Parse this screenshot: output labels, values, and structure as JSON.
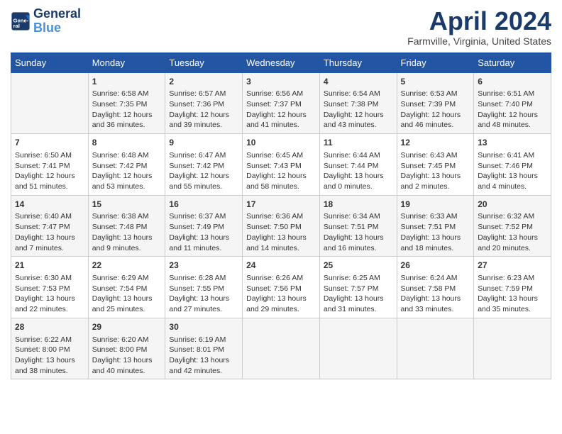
{
  "header": {
    "logo_line1": "General",
    "logo_line2": "Blue",
    "month": "April 2024",
    "location": "Farmville, Virginia, United States"
  },
  "weekdays": [
    "Sunday",
    "Monday",
    "Tuesday",
    "Wednesday",
    "Thursday",
    "Friday",
    "Saturday"
  ],
  "weeks": [
    [
      {
        "day": "",
        "info": ""
      },
      {
        "day": "1",
        "info": "Sunrise: 6:58 AM\nSunset: 7:35 PM\nDaylight: 12 hours\nand 36 minutes."
      },
      {
        "day": "2",
        "info": "Sunrise: 6:57 AM\nSunset: 7:36 PM\nDaylight: 12 hours\nand 39 minutes."
      },
      {
        "day": "3",
        "info": "Sunrise: 6:56 AM\nSunset: 7:37 PM\nDaylight: 12 hours\nand 41 minutes."
      },
      {
        "day": "4",
        "info": "Sunrise: 6:54 AM\nSunset: 7:38 PM\nDaylight: 12 hours\nand 43 minutes."
      },
      {
        "day": "5",
        "info": "Sunrise: 6:53 AM\nSunset: 7:39 PM\nDaylight: 12 hours\nand 46 minutes."
      },
      {
        "day": "6",
        "info": "Sunrise: 6:51 AM\nSunset: 7:40 PM\nDaylight: 12 hours\nand 48 minutes."
      }
    ],
    [
      {
        "day": "7",
        "info": "Sunrise: 6:50 AM\nSunset: 7:41 PM\nDaylight: 12 hours\nand 51 minutes."
      },
      {
        "day": "8",
        "info": "Sunrise: 6:48 AM\nSunset: 7:42 PM\nDaylight: 12 hours\nand 53 minutes."
      },
      {
        "day": "9",
        "info": "Sunrise: 6:47 AM\nSunset: 7:42 PM\nDaylight: 12 hours\nand 55 minutes."
      },
      {
        "day": "10",
        "info": "Sunrise: 6:45 AM\nSunset: 7:43 PM\nDaylight: 12 hours\nand 58 minutes."
      },
      {
        "day": "11",
        "info": "Sunrise: 6:44 AM\nSunset: 7:44 PM\nDaylight: 13 hours\nand 0 minutes."
      },
      {
        "day": "12",
        "info": "Sunrise: 6:43 AM\nSunset: 7:45 PM\nDaylight: 13 hours\nand 2 minutes."
      },
      {
        "day": "13",
        "info": "Sunrise: 6:41 AM\nSunset: 7:46 PM\nDaylight: 13 hours\nand 4 minutes."
      }
    ],
    [
      {
        "day": "14",
        "info": "Sunrise: 6:40 AM\nSunset: 7:47 PM\nDaylight: 13 hours\nand 7 minutes."
      },
      {
        "day": "15",
        "info": "Sunrise: 6:38 AM\nSunset: 7:48 PM\nDaylight: 13 hours\nand 9 minutes."
      },
      {
        "day": "16",
        "info": "Sunrise: 6:37 AM\nSunset: 7:49 PM\nDaylight: 13 hours\nand 11 minutes."
      },
      {
        "day": "17",
        "info": "Sunrise: 6:36 AM\nSunset: 7:50 PM\nDaylight: 13 hours\nand 14 minutes."
      },
      {
        "day": "18",
        "info": "Sunrise: 6:34 AM\nSunset: 7:51 PM\nDaylight: 13 hours\nand 16 minutes."
      },
      {
        "day": "19",
        "info": "Sunrise: 6:33 AM\nSunset: 7:51 PM\nDaylight: 13 hours\nand 18 minutes."
      },
      {
        "day": "20",
        "info": "Sunrise: 6:32 AM\nSunset: 7:52 PM\nDaylight: 13 hours\nand 20 minutes."
      }
    ],
    [
      {
        "day": "21",
        "info": "Sunrise: 6:30 AM\nSunset: 7:53 PM\nDaylight: 13 hours\nand 22 minutes."
      },
      {
        "day": "22",
        "info": "Sunrise: 6:29 AM\nSunset: 7:54 PM\nDaylight: 13 hours\nand 25 minutes."
      },
      {
        "day": "23",
        "info": "Sunrise: 6:28 AM\nSunset: 7:55 PM\nDaylight: 13 hours\nand 27 minutes."
      },
      {
        "day": "24",
        "info": "Sunrise: 6:26 AM\nSunset: 7:56 PM\nDaylight: 13 hours\nand 29 minutes."
      },
      {
        "day": "25",
        "info": "Sunrise: 6:25 AM\nSunset: 7:57 PM\nDaylight: 13 hours\nand 31 minutes."
      },
      {
        "day": "26",
        "info": "Sunrise: 6:24 AM\nSunset: 7:58 PM\nDaylight: 13 hours\nand 33 minutes."
      },
      {
        "day": "27",
        "info": "Sunrise: 6:23 AM\nSunset: 7:59 PM\nDaylight: 13 hours\nand 35 minutes."
      }
    ],
    [
      {
        "day": "28",
        "info": "Sunrise: 6:22 AM\nSunset: 8:00 PM\nDaylight: 13 hours\nand 38 minutes."
      },
      {
        "day": "29",
        "info": "Sunrise: 6:20 AM\nSunset: 8:00 PM\nDaylight: 13 hours\nand 40 minutes."
      },
      {
        "day": "30",
        "info": "Sunrise: 6:19 AM\nSunset: 8:01 PM\nDaylight: 13 hours\nand 42 minutes."
      },
      {
        "day": "",
        "info": ""
      },
      {
        "day": "",
        "info": ""
      },
      {
        "day": "",
        "info": ""
      },
      {
        "day": "",
        "info": ""
      }
    ]
  ]
}
